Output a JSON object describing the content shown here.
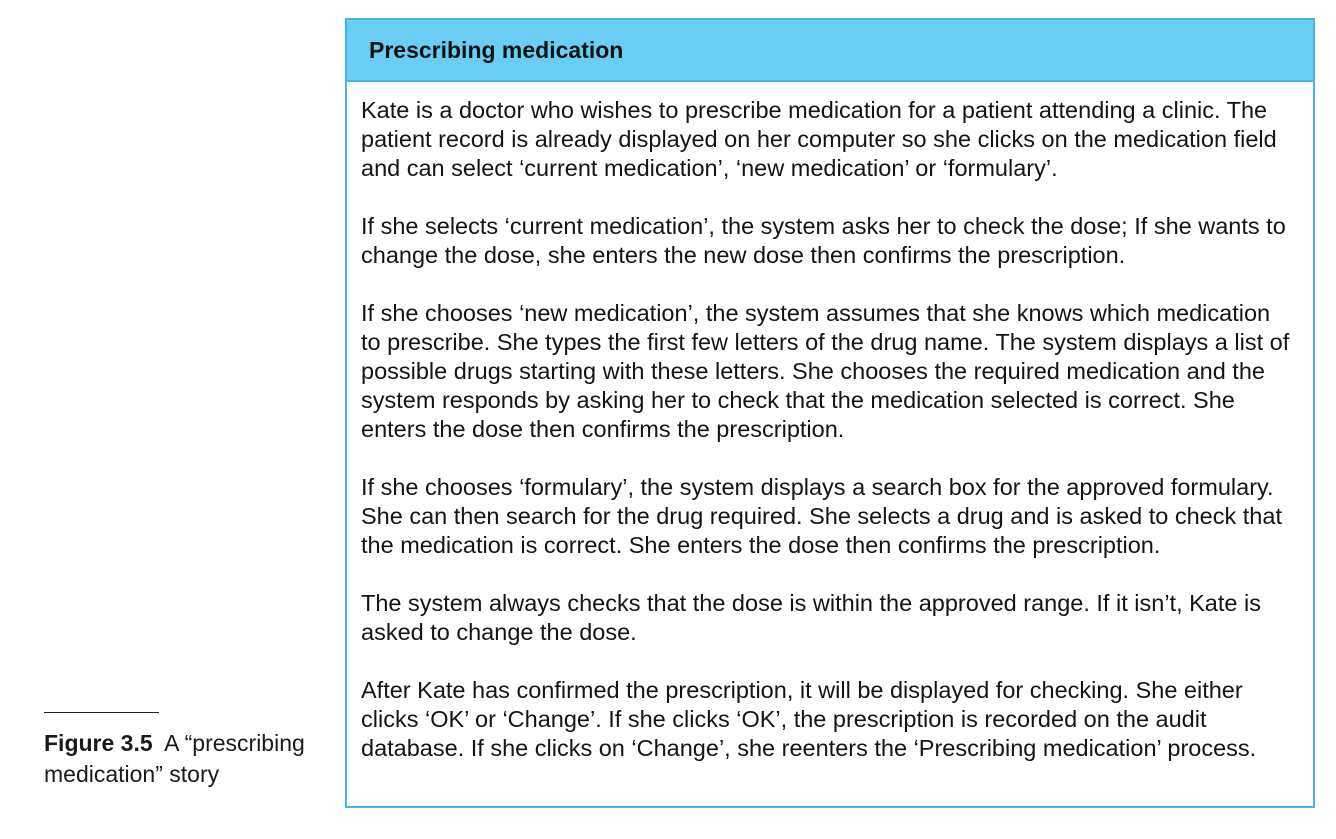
{
  "caption": {
    "label": "Figure 3.5",
    "text": "A “prescribing medication” story"
  },
  "story": {
    "title": "Prescribing medication",
    "paragraphs": [
      "Kate is a doctor who wishes to prescribe medication for a patient attending a clinic. The patient record is already displayed on her computer so she clicks on the medication field and can select ‘current medication’, ‘new medication’ or ‘formulary’.",
      "If she selects ‘current medication’, the system asks her to check the dose; If she wants to change the dose, she enters the new dose then confirms the prescription.",
      "If she chooses ‘new medication’, the system assumes that she knows which medication to prescribe. She types the first few letters of the drug name. The system displays a list of possible drugs starting with these letters. She chooses the required medication and the system responds by asking her to check that the medication selected is correct. She enters the dose then confirms the prescription.",
      "If she chooses ‘formulary’, the system displays a search box for the approved formulary. She can then search for the drug required. She selects a drug and is asked to check that the medication is correct. She enters the dose then confirms the prescription.",
      "The system always checks that the dose is within the approved range. If it isn’t, Kate is asked to change the dose.",
      "After Kate has confirmed the prescription, it will be displayed for checking. She either clicks ‘OK’ or ‘Change’. If she clicks ‘OK’, the prescription is recorded on the audit database. If she clicks on ‘Change’, she reenters the ‘Prescribing medication’ process."
    ]
  },
  "colors": {
    "header_background": "#69cdf4",
    "border": "#48b5ea"
  }
}
